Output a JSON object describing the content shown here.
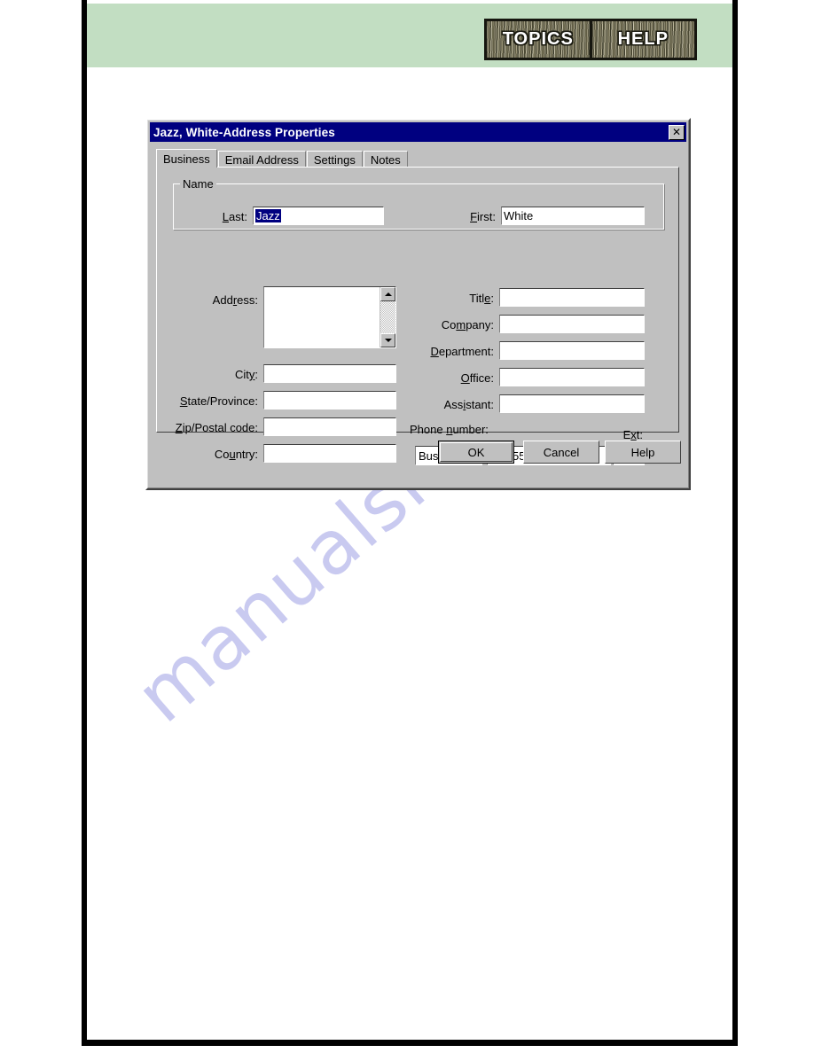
{
  "header": {
    "nav_buttons": [
      {
        "label": "TOPICS",
        "name": "topics-button"
      },
      {
        "label": "HELP",
        "name": "help-button"
      }
    ],
    "band_color": "#c2dec2"
  },
  "watermark": {
    "text": "manualshive.com",
    "color": "#c9caf0"
  },
  "dialog": {
    "title": "Jazz, White-Address Properties",
    "titlebar_color": "#000080",
    "close_glyph": "✕",
    "tabs": [
      {
        "label": "Business",
        "active": true
      },
      {
        "label": "Email Address",
        "active": false
      },
      {
        "label": "Settings",
        "active": false
      },
      {
        "label": "Notes",
        "active": false
      }
    ],
    "name_group": {
      "legend": "Name",
      "last_label": "Last:",
      "last_accel": "L",
      "last_value": "Jazz",
      "last_value_selected": true,
      "first_label": "First:",
      "first_accel": "F",
      "first_value": "White"
    },
    "left_fields": [
      {
        "label": "Address:",
        "accel": "r",
        "value": "",
        "multiline": true
      },
      {
        "label": "City:",
        "accel": "y",
        "value": ""
      },
      {
        "label": "State/Province:",
        "accel": "S",
        "value": ""
      },
      {
        "label": "Zip/Postal code:",
        "accel": "Z",
        "value": ""
      },
      {
        "label": "Country:",
        "accel": "u",
        "value": ""
      }
    ],
    "right_fields": [
      {
        "label": "Title:",
        "accel": "e",
        "value": ""
      },
      {
        "label": "Company:",
        "accel": "m",
        "value": ""
      },
      {
        "label": "Department:",
        "accel": "D",
        "value": ""
      },
      {
        "label": "Office:",
        "accel": "O",
        "value": ""
      },
      {
        "label": "Assistant:",
        "accel": "i",
        "value": ""
      }
    ],
    "phone": {
      "group_label": "Phone number:",
      "group_accel": "n",
      "type_value": "Business",
      "number_value": "555-5555",
      "ext_label": "Ext:",
      "ext_accel": "x",
      "ext_value": ""
    },
    "buttons": [
      {
        "label": "OK",
        "default": true
      },
      {
        "label": "Cancel",
        "default": false
      },
      {
        "label": "Help",
        "default": false
      }
    ]
  }
}
